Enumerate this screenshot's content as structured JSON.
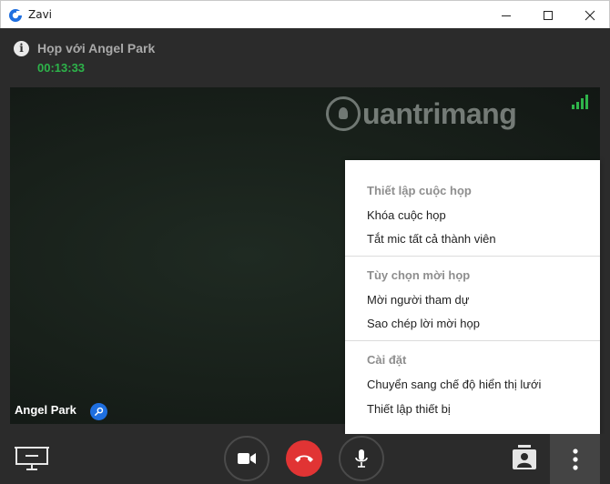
{
  "window": {
    "title": "Zavi",
    "controls": [
      "minimize",
      "maximize",
      "close"
    ]
  },
  "meeting": {
    "title": "Họp với Angel Park",
    "timer": "00:13:33"
  },
  "video": {
    "participant_name": "Angel Park",
    "watermark": "uantrimang",
    "signal_bars": 4
  },
  "menu": {
    "sections": [
      {
        "header": "Thiết lập cuộc họp",
        "items": [
          "Khóa cuộc họp",
          "Tắt mic tất cả thành viên"
        ]
      },
      {
        "header": "Tùy chọn mời họp",
        "items": [
          "Mời người tham dự",
          "Sao chép lời mời họp"
        ]
      },
      {
        "header": "Cài đặt",
        "items": [
          "Chuyển sang chế độ hiển thị lưới",
          "Thiết lập thiết bị"
        ]
      }
    ]
  },
  "toolbar": {
    "buttons": [
      "screen-share-icon",
      "camera-icon",
      "hang-up-icon",
      "microphone-icon",
      "participants-icon",
      "more-options-icon"
    ]
  },
  "colors": {
    "accent_green": "#2db34a",
    "hangup_red": "#e13434",
    "pin_blue": "#1f6fe0"
  }
}
